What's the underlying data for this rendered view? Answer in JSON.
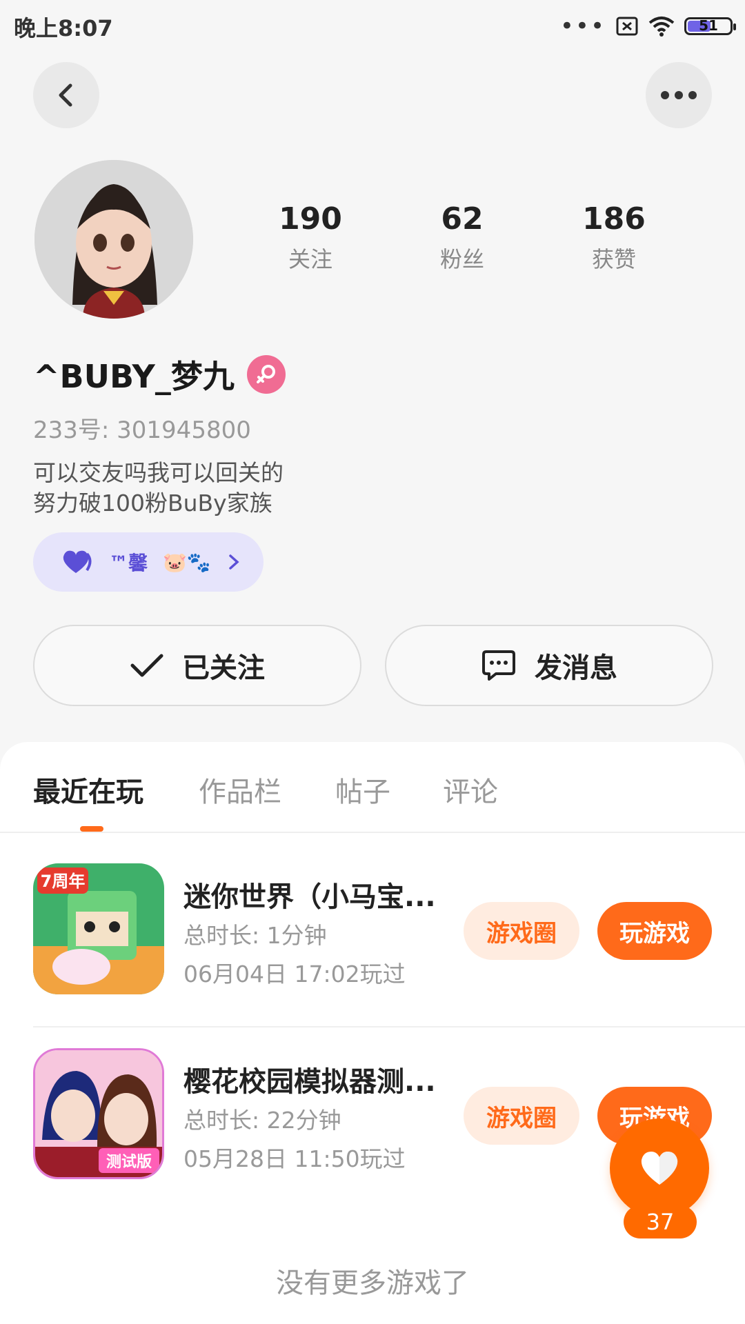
{
  "status_bar": {
    "time": "晚上8:07",
    "dots": "•••",
    "battery": "51"
  },
  "profile": {
    "stats": [
      {
        "value": "190",
        "label": "关注"
      },
      {
        "value": "62",
        "label": "粉丝"
      },
      {
        "value": "186",
        "label": "获赞"
      }
    ],
    "username": "^BUBY_梦九",
    "uid": "233号: 301945800",
    "bio_lines": [
      "可以交友吗我可以回关的",
      "努力破100粉BuBy家族"
    ],
    "family": {
      "name": "™馨",
      "emoji": "🐷🐾"
    }
  },
  "actions": {
    "followed": "已关注",
    "message": "发消息"
  },
  "tabs": [
    "最近在玩",
    "作品栏",
    "帖子",
    "评论"
  ],
  "games": [
    {
      "title": "迷你世界（小马宝...",
      "duration": "总时长: 1分钟",
      "played": "06月04日 17:02玩过",
      "circle_label": "游戏圈",
      "play_label": "玩游戏",
      "badge": "7周年"
    },
    {
      "title": "樱花校园模拟器测...",
      "duration": "总时长: 22分钟",
      "played": "05月28日 11:50玩过",
      "circle_label": "游戏圈",
      "play_label": "玩游戏",
      "badge": "测试版"
    }
  ],
  "footer": {
    "no_more": "没有更多游戏了"
  },
  "float_like": {
    "count": "37"
  },
  "colors": {
    "accent": "#ff6a1a",
    "gender": "#f06c93",
    "family_bg": "#e6e4fb"
  }
}
